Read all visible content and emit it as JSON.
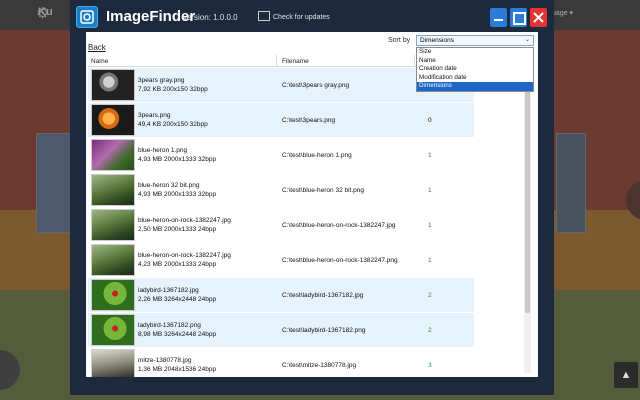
{
  "background": {
    "logo_fragment": "Ku",
    "lang_fragment": "uage ▾",
    "up_icon": "caret-up-icon"
  },
  "app": {
    "title": "ImageFinder",
    "version": "Version: 1.0.0.0",
    "check_updates": "Check for updates",
    "back": "Back",
    "sort_label": "Sort by",
    "sort_value": "Dimensions",
    "sort_options": [
      "Size",
      "Name",
      "Creation date",
      "Modification date",
      "Dimensions"
    ],
    "columns": {
      "name": "Name",
      "filename": "Filename"
    },
    "accent_color": "#1d66c8",
    "close_color": "#e3342f"
  },
  "rows": [
    {
      "name": "3pears gray.png",
      "meta": "7,92 KB  200x150  32bpp",
      "path": "C:\\test\\3pears gray.png",
      "group": "",
      "thumb": "pears-gray",
      "highlight": true
    },
    {
      "name": "3pears.png",
      "meta": "49,4 KB  200x150  32bpp",
      "path": "C:\\test\\3pears.png",
      "group": "0",
      "thumb": "pears-orange",
      "highlight": true
    },
    {
      "name": "blue-heron 1.png",
      "meta": "4,93 MB  2000x1333  32bpp",
      "path": "C:\\test\\blue-heron 1.png",
      "group": "1",
      "thumb": "heron-purple",
      "highlight": false
    },
    {
      "name": "blue-heron 32 bit.png",
      "meta": "4,93 MB  2000x1333  32bpp",
      "path": "C:\\test\\blue-heron 32 bit.png",
      "group": "1",
      "thumb": "heron-green",
      "highlight": false
    },
    {
      "name": "blue-heron-on-rock-1382247.jpg",
      "meta": "2,50 MB  2000x1333  24bpp",
      "path": "C:\\test\\blue-heron-on-rock-1382247.jpg",
      "group": "1",
      "thumb": "heron-green",
      "highlight": false
    },
    {
      "name": "blue-heron-on-rock-1382247.jpg",
      "meta": "4,23 MB  2000x1333  24bpp",
      "path": "C:\\test\\blue-heron-on-rock-1382247.png",
      "group": "1",
      "thumb": "heron-green",
      "highlight": false
    },
    {
      "name": "ladybird-1367182.jpg",
      "meta": "2,26 MB  3264x2448  24bpp",
      "path": "C:\\test\\ladybird-1367182.jpg",
      "group": "2",
      "thumb": "ladybird",
      "highlight": true
    },
    {
      "name": "ladybird-1367182.png",
      "meta": "8,98 MB  3264x2448  24bpp",
      "path": "C:\\test\\ladybird-1367182.png",
      "group": "2",
      "thumb": "ladybird",
      "highlight": true
    },
    {
      "name": "mitze-1380778.jpg",
      "meta": "1,36 MB  2048x1536  24bpp",
      "path": "C:\\test\\mitze-1380778.jpg",
      "group": "3",
      "thumb": "cat",
      "highlight": false
    }
  ]
}
